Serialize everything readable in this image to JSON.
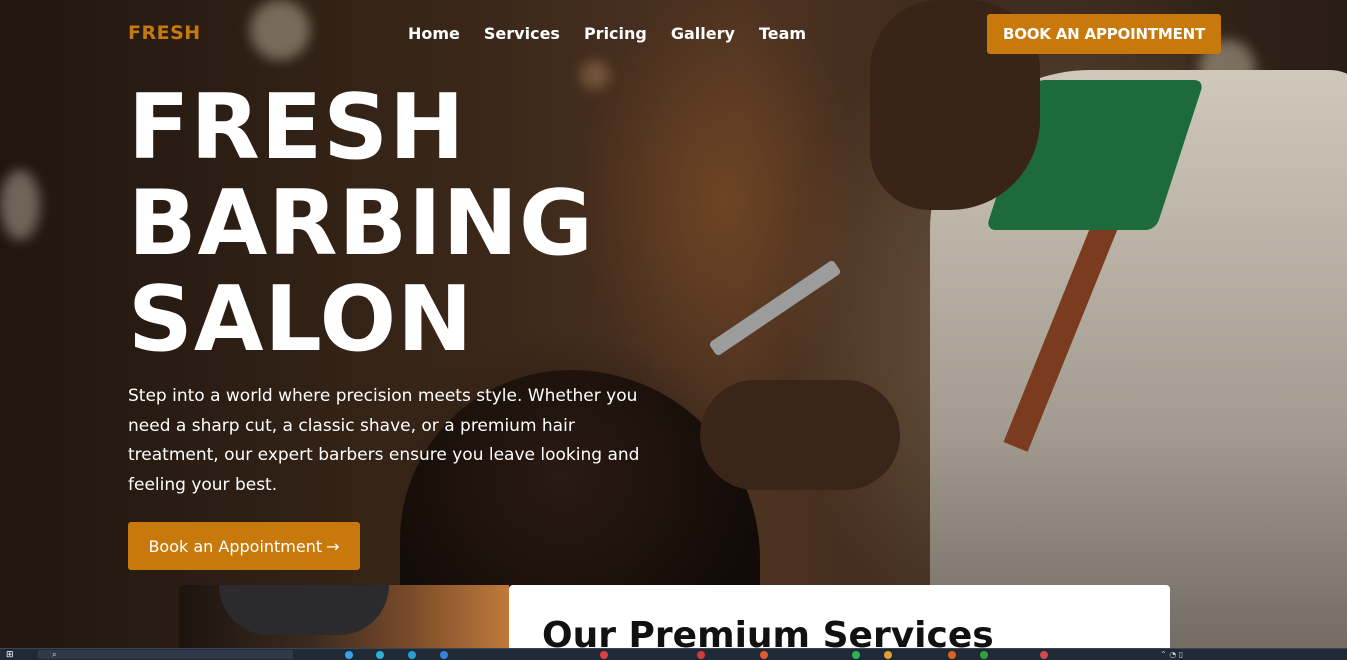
{
  "brand": {
    "logo": "FRESH",
    "accent": "#c8790c"
  },
  "nav": {
    "items": [
      {
        "label": "Home"
      },
      {
        "label": "Services"
      },
      {
        "label": "Pricing"
      },
      {
        "label": "Gallery"
      },
      {
        "label": "Team"
      }
    ],
    "cta_label": "BOOK AN APPOINTMENT"
  },
  "hero": {
    "title_lines": [
      "FRESH",
      "BARBING",
      "SALON"
    ],
    "description": "Step into a world where precision meets style. Whether you need a sharp cut, a classic shave, or a premium hair treatment, our expert barbers ensure you leave looking and feeling your best.",
    "cta_label": "Book an Appointment",
    "cta_arrow": "→"
  },
  "services": {
    "heading": "Our Premium Services"
  },
  "taskbar": {
    "icons": [
      "windows-start-icon",
      "search-icon",
      "app-icon"
    ],
    "colors": [
      "#3aa0e8",
      "#2fb0d8",
      "#2a9fd0",
      "#3a7fe0",
      "#e04040",
      "#d03a3a",
      "#e05a30",
      "#30b050",
      "#e0a030",
      "#e06020",
      "#30a040",
      "#d04a4a"
    ]
  }
}
